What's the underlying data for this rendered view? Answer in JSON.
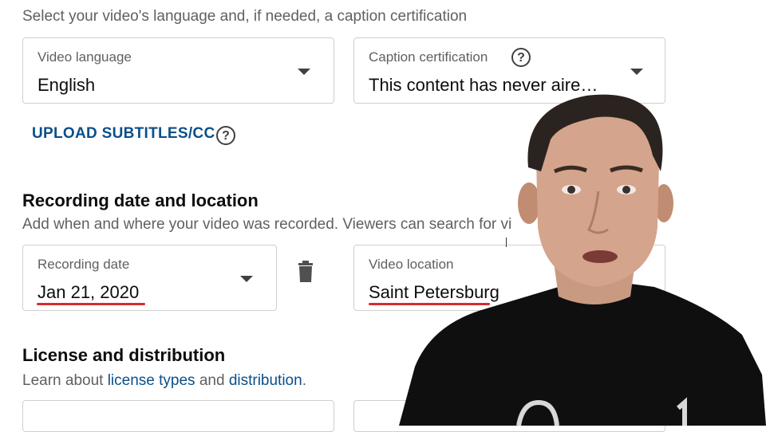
{
  "language_section": {
    "description": "Select your video's language and, if needed, a caption certification",
    "video_language": {
      "label": "Video language",
      "value": "English"
    },
    "caption_certification": {
      "label": "Caption certification",
      "value": "This content has never aire…"
    },
    "upload_subtitles_label": "UPLOAD SUBTITLES/CC"
  },
  "recording_section": {
    "title": "Recording date and location",
    "description": "Add when and where your video was recorded. Viewers can search for vi",
    "recording_date": {
      "label": "Recording date",
      "value": "Jan 21, 2020"
    },
    "video_location": {
      "label": "Video location",
      "value": "Saint Petersburg"
    }
  },
  "license_section": {
    "title": "License and distribution",
    "description_prefix": "Learn about ",
    "license_types_link": "license types",
    "and_text": " and ",
    "distribution_link": "distribution",
    "period": "."
  },
  "colors": {
    "accent_link": "#0b4f8a",
    "annotation_underline": "#d92b2b",
    "shirt": "#0f0f10"
  },
  "icons": {
    "dropdown": "caret-down-icon",
    "help": "help-circle-icon",
    "delete": "trash-icon"
  }
}
